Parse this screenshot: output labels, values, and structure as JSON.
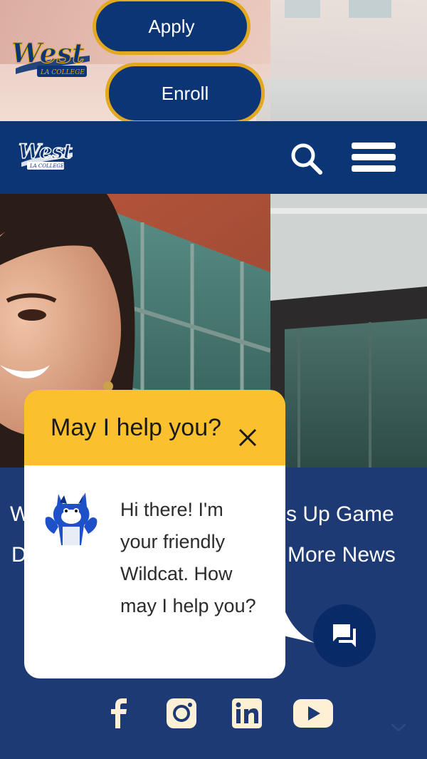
{
  "banner": {
    "apply_label": "Apply",
    "enroll_label": "Enroll",
    "logo_text": "West",
    "logo_subtext": "LA COLLEGE"
  },
  "nav": {
    "logo_text": "West",
    "logo_subtext": "LA COLLEGE",
    "icons": [
      "search-icon",
      "menu-icon"
    ]
  },
  "news": {
    "line1_fragment": "W",
    "line1": "s Up Game",
    "line2_fragment": "D",
    "line2": "More News"
  },
  "social": [
    "facebook-icon",
    "instagram-icon",
    "linkedin-icon",
    "youtube-icon"
  ],
  "chat": {
    "title": "May I help you?",
    "message": "Hi there! I'm your friendly Wildcat. How may I help you?"
  },
  "colors": {
    "navy": "#0c3575",
    "gold": "#e2a81f",
    "chat_yellow": "#fbc02d",
    "news_bg": "#1e3a74",
    "social_cream": "#fdf0d5"
  }
}
